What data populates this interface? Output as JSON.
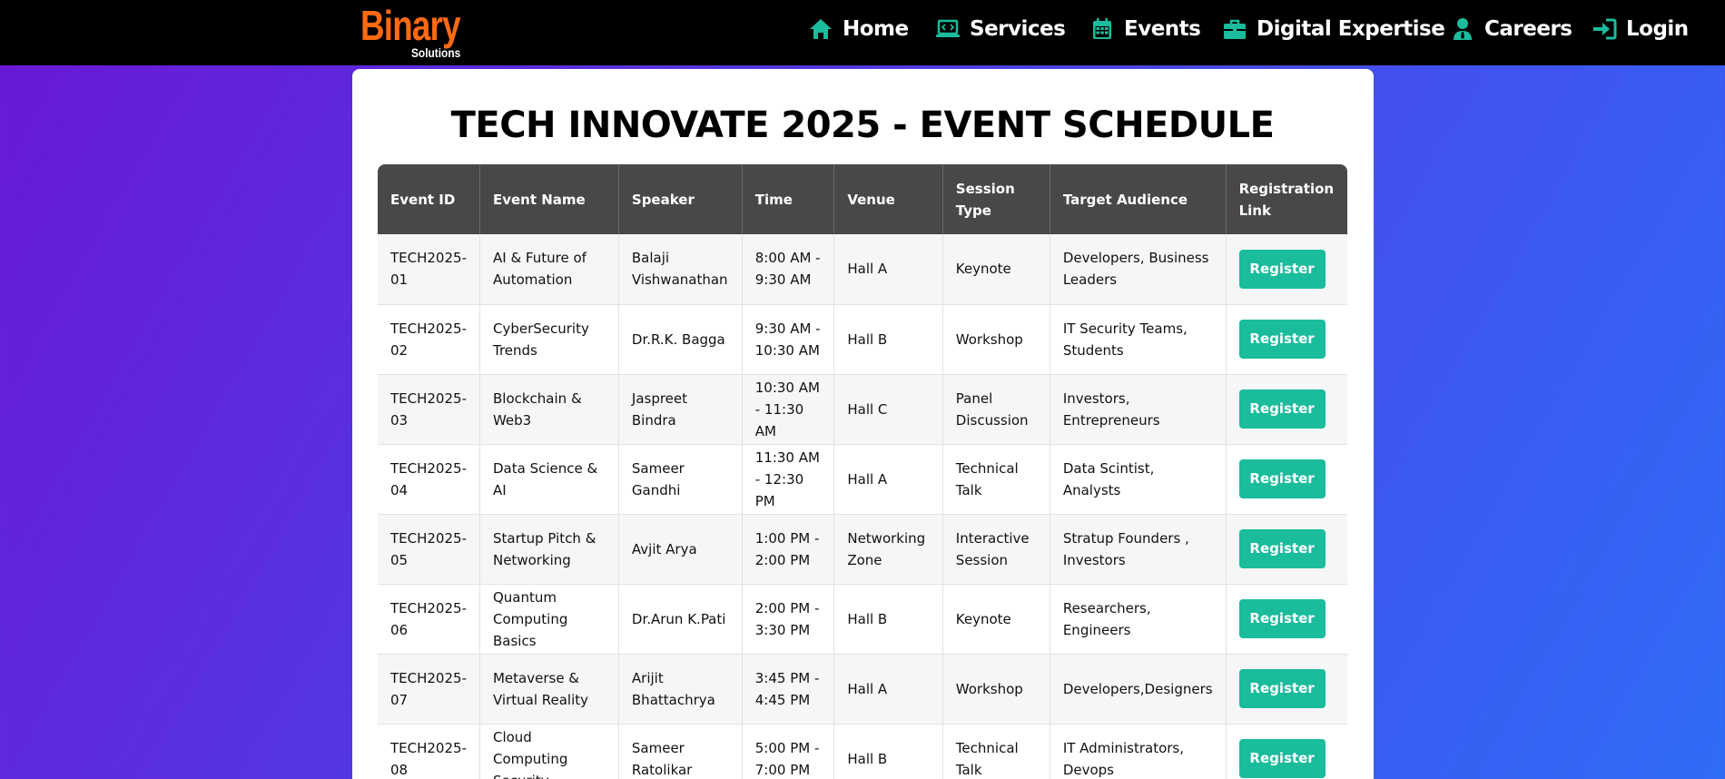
{
  "header": {
    "logo_main": "Binary",
    "logo_sub": "Solutions",
    "nav": [
      {
        "label": "Home",
        "icon": "home-icon"
      },
      {
        "label": "Services",
        "icon": "laptop-code-icon"
      },
      {
        "label": "Events",
        "icon": "calendar-icon"
      },
      {
        "label": "Digital Expertise",
        "icon": "briefcase-icon"
      },
      {
        "label": "Careers",
        "icon": "user-tie-icon"
      },
      {
        "label": "Login",
        "icon": "sign-in-icon"
      }
    ],
    "accent": "#1abc9c",
    "logo_color": "#ff6a13"
  },
  "main": {
    "title": "TECH INNOVATE 2025 - EVENT SCHEDULE",
    "columns": [
      "Event ID",
      "Event Name",
      "Speaker",
      "Time",
      "Venue",
      "Session Type",
      "Target Audience",
      "Registration Link"
    ],
    "rows": [
      {
        "id": "TECH2025-01",
        "name": "AI & Future of Automation",
        "speaker": "Balaji Vishwanathan",
        "time": "8:00 AM - 9:30 AM",
        "venue": "Hall A",
        "type": "Keynote",
        "audience": "Developers, Business Leaders",
        "action": "Register"
      },
      {
        "id": "TECH2025-02",
        "name": "CyberSecurity Trends",
        "speaker": "Dr.R.K. Bagga",
        "time": "9:30 AM - 10:30 AM",
        "venue": "Hall B",
        "type": "Workshop",
        "audience": "IT Security Teams, Students",
        "action": "Register"
      },
      {
        "id": "TECH2025-03",
        "name": "Blockchain & Web3",
        "speaker": "Jaspreet Bindra",
        "time": "10:30 AM - 11:30 AM",
        "venue": "Hall C",
        "type": "Panel Discussion",
        "audience": "Investors, Entrepreneurs",
        "action": "Register"
      },
      {
        "id": "TECH2025-04",
        "name": "Data Science & AI",
        "speaker": "Sameer Gandhi",
        "time": "11:30 AM - 12:30 PM",
        "venue": "Hall A",
        "type": "Technical Talk",
        "audience": "Data Scintist, Analysts",
        "action": "Register"
      },
      {
        "id": "TECH2025-05",
        "name": "Startup Pitch & Networking",
        "speaker": "Avjit Arya",
        "time": "1:00 PM - 2:00 PM",
        "venue": "Networking Zone",
        "type": "Interactive Session",
        "audience": "Stratup Founders , Investors",
        "action": "Register"
      },
      {
        "id": "TECH2025-06",
        "name": "Quantum Computing Basics",
        "speaker": "Dr.Arun K.Pati",
        "time": "2:00 PM - 3:30 PM",
        "venue": "Hall B",
        "type": "Keynote",
        "audience": "Researchers, Engineers",
        "action": "Register"
      },
      {
        "id": "TECH2025-07",
        "name": "Metaverse & Virtual Reality",
        "speaker": "Arijit Bhattachrya",
        "time": "3:45 PM - 4:45 PM",
        "venue": "Hall A",
        "type": "Workshop",
        "audience": "Developers,Designers",
        "action": "Register"
      },
      {
        "id": "TECH2025-08",
        "name": "Cloud Computing Security",
        "speaker": "Sameer Ratolikar",
        "time": "5:00 PM - 7:00 PM",
        "venue": "Hall B",
        "type": "Technical Talk",
        "audience": "IT Administrators, Devops",
        "action": "Register"
      }
    ]
  }
}
